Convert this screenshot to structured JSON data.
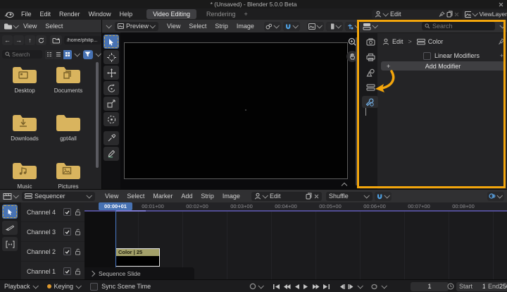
{
  "window": {
    "title": "* (Unsaved) - Blender 5.0.0 Beta"
  },
  "topbar": {
    "menus": [
      "File",
      "Edit",
      "Render",
      "Window",
      "Help"
    ],
    "tabs": [
      "Video Editing",
      "Rendering"
    ],
    "new_tab": "+",
    "scene_value": "Edit",
    "view_layer_value": "ViewLayer"
  },
  "file_browser": {
    "menus": [
      "View",
      "Select"
    ],
    "path": "/home/philip...",
    "search_placeholder": "Search",
    "folders": [
      "Desktop",
      "Documents",
      "Downloads",
      "gpt4all",
      "Music",
      "Pictures"
    ]
  },
  "preview": {
    "editor_label": "Preview",
    "menus": [
      "View",
      "Select",
      "Strip",
      "Image"
    ]
  },
  "properties": {
    "search_placeholder": "Search",
    "breadcrumb_scene": "Edit",
    "breadcrumb_sep": ">",
    "breadcrumb_strip": "Color",
    "linear_modifiers": "Linear Modifiers",
    "add_modifier": "Add Modifier",
    "plus": "+",
    "extras_plus": "+"
  },
  "sequencer": {
    "editor_label": "Sequencer",
    "menus": [
      "View",
      "Select",
      "Marker",
      "Add",
      "Strip",
      "Image"
    ],
    "scene_value": "Edit",
    "overlap_mode": "Shuffle",
    "channels": [
      "Channel 4",
      "Channel 3",
      "Channel 2",
      "Channel 1"
    ],
    "ruler": [
      "00:01+00",
      "00:02+00",
      "00:03+00",
      "00:04+00",
      "00:05+00",
      "00:06+00",
      "00:07+00",
      "00:08+00"
    ],
    "playhead": "00:00+01",
    "strip_label": "Color | 25",
    "footer": "Sequence Slide"
  },
  "statusbar": {
    "playback": "Playback",
    "keying": "Keying",
    "sync": "Sync Scene Time",
    "frame": "1",
    "start_label": "Start",
    "start": "1",
    "end_label": "End",
    "end": "250"
  },
  "colors": {
    "annotation": "#f2a50c",
    "accent": "#4772b3",
    "strip_header": "#a3a069",
    "folder": "#d9b45e"
  }
}
